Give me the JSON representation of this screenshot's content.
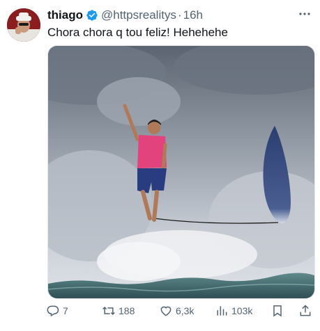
{
  "author": {
    "display_name": "thiago",
    "handle": "@httpsrealitys",
    "separator": "·",
    "time": "16h"
  },
  "tweet": {
    "text": "Chora chora q tou feliz! Hehehehe"
  },
  "metrics": {
    "replies": "7",
    "retweets": "188",
    "likes": "6,3k",
    "views": "103k"
  },
  "colors": {
    "verified_badge": "#1d9bf0",
    "secondary_text": "#536471",
    "primary_text": "#0f1419"
  },
  "icons": [
    "verified-badge-icon",
    "more-icon",
    "reply-icon",
    "retweet-icon",
    "like-icon",
    "views-icon",
    "bookmark-icon",
    "share-icon"
  ]
}
